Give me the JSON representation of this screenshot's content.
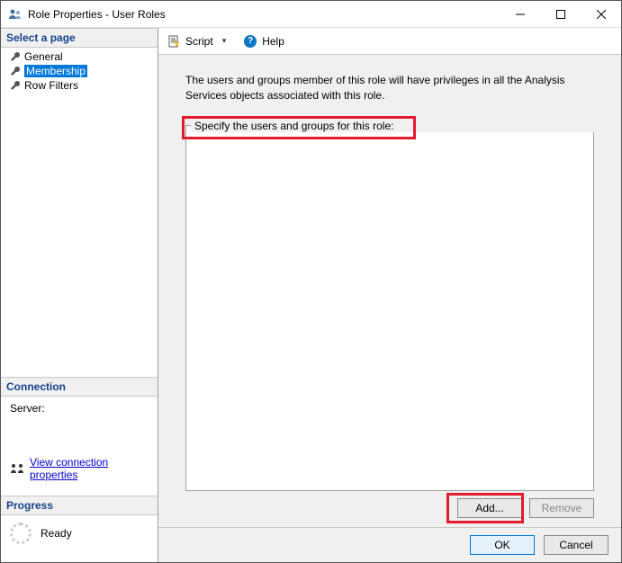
{
  "window": {
    "title": "Role Properties - User Roles"
  },
  "sidebar": {
    "select_page_header": "Select a page",
    "pages": [
      {
        "label": "General"
      },
      {
        "label": "Membership"
      },
      {
        "label": "Row Filters"
      }
    ],
    "connection_header": "Connection",
    "server_label": "Server:",
    "view_conn_link": "View connection properties",
    "progress_header": "Progress",
    "progress_status": "Ready"
  },
  "toolbar": {
    "script_label": "Script",
    "help_label": "Help"
  },
  "main": {
    "description": "The users and groups member of this role will have privileges in all the Analysis Services objects associated with this role.",
    "specify_label": "Specify the users and groups for this role:",
    "add_button": "Add...",
    "remove_button": "Remove"
  },
  "footer": {
    "ok": "OK",
    "cancel": "Cancel"
  }
}
